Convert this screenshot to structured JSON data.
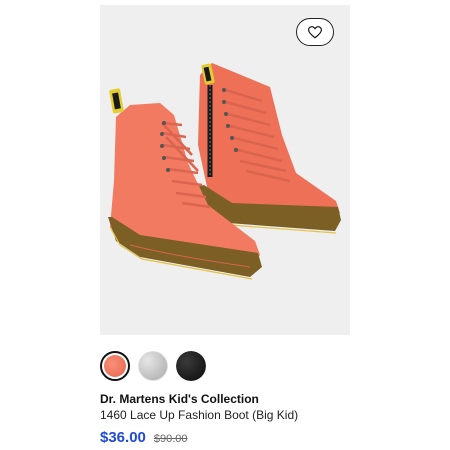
{
  "product": {
    "brand": "Dr. Martens Kid's Collection",
    "name": "1460 Lace Up Fashion Boot (Big Kid)",
    "sale_price": "$36.00",
    "original_price": "$90.00",
    "sale_price_color": "#1f4bd8"
  },
  "image": {
    "alt": "Coral lace-up boots",
    "boot_color": "#f27a60",
    "sole_color": "#8a6a2a",
    "background_color": "#efefef"
  },
  "favorite": {
    "icon": "heart-icon"
  },
  "swatches": [
    {
      "name": "coral",
      "color": "#f27a60",
      "selected": true
    },
    {
      "name": "silver-glitter",
      "color": "#c8c8c8",
      "selected": false
    },
    {
      "name": "black",
      "color": "#111111",
      "selected": false
    }
  ]
}
